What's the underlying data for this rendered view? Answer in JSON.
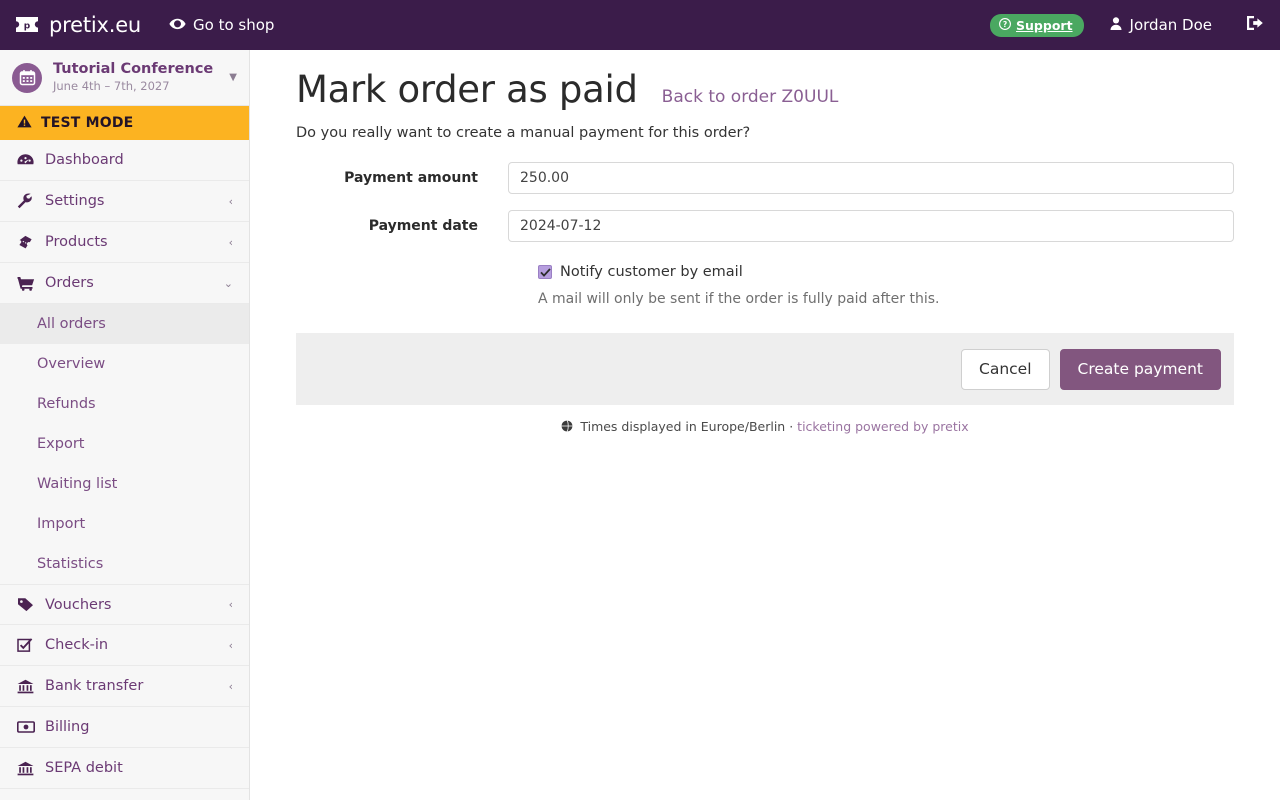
{
  "topbar": {
    "brand_label": "pretix.eu",
    "brand_logo_icon": "pretix-ticket-logo",
    "shop_link_label": "Go to shop",
    "shop_link_icon": "eye-icon",
    "support_label": "Support",
    "support_icon": "question-circle-icon",
    "support_color": "#4aa861",
    "user_label": "Jordan Doe",
    "user_icon": "user-icon",
    "logout_icon": "sign-out-icon",
    "background_color": "#3b1c4a"
  },
  "sidebar": {
    "event": {
      "name": "Tutorial Conference",
      "date_range": "June 4th – 7th, 2027",
      "avatar_icon": "calendar-icon",
      "caret_icon": "caret-down-icon"
    },
    "test_mode": {
      "label": "TEST MODE",
      "icon": "warning-triangle-icon",
      "background_color": "#fcb321"
    },
    "items": [
      {
        "label": "Dashboard",
        "icon": "dashboard-icon",
        "chevron": ""
      },
      {
        "label": "Settings",
        "icon": "wrench-icon",
        "chevron": "‹"
      },
      {
        "label": "Products",
        "icon": "tickets-icon",
        "chevron": "‹"
      },
      {
        "label": "Orders",
        "icon": "shopping-cart-icon",
        "chevron": "⌄"
      }
    ],
    "orders_subitems": [
      {
        "label": "All orders",
        "active": true
      },
      {
        "label": "Overview",
        "active": false
      },
      {
        "label": "Refunds",
        "active": false
      },
      {
        "label": "Export",
        "active": false
      },
      {
        "label": "Waiting list",
        "active": false
      },
      {
        "label": "Import",
        "active": false
      },
      {
        "label": "Statistics",
        "active": false
      }
    ],
    "items_after": [
      {
        "label": "Vouchers",
        "icon": "tag-icon",
        "chevron": "‹"
      },
      {
        "label": "Check-in",
        "icon": "check-square-icon",
        "chevron": "‹"
      },
      {
        "label": "Bank transfer",
        "icon": "bank-icon",
        "chevron": "‹"
      },
      {
        "label": "Billing",
        "icon": "money-bill-icon",
        "chevron": ""
      },
      {
        "label": "SEPA debit",
        "icon": "bank-icon",
        "chevron": ""
      }
    ]
  },
  "main": {
    "title": "Mark order as paid",
    "back_link_label": "Back to order Z0UUL",
    "lead": "Do you really want to create a manual payment for this order?",
    "fields": {
      "amount_label": "Payment amount",
      "amount_value": "250.00",
      "date_label": "Payment date",
      "date_value": "2024-07-12"
    },
    "notify": {
      "label": "Notify customer by email",
      "checked": true,
      "check_icon": "checkmark-icon",
      "help_text": "A mail will only be sent if the order is fully paid after this."
    },
    "actions": {
      "cancel_label": "Cancel",
      "submit_label": "Create payment",
      "submit_color": "#82567f"
    },
    "footer": {
      "globe_icon": "globe-icon",
      "timezone_text": "Times displayed in Europe/Berlin",
      "separator": "·",
      "link_label": "ticketing powered by pretix"
    }
  }
}
